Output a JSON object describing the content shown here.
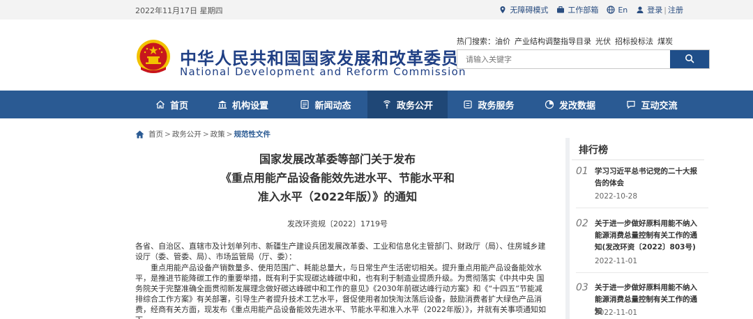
{
  "topbar": {
    "date": "2022年11月17日 星期四",
    "accessibility": "无障碍模式",
    "work_dept": "工作部箱",
    "lang": "En",
    "login": "登录",
    "sep": "|",
    "register": "注册"
  },
  "header": {
    "title_cn": "中华人民共和国国家发展和改革委员会",
    "title_en": "National Development and Reform Commission",
    "hot_label": "热门搜索：",
    "hot_items": [
      "油价",
      "产业结构调整指导目录",
      "光伏",
      "招标投标法",
      "煤炭"
    ],
    "search_placeholder": "请输入关键字"
  },
  "nav": [
    {
      "label": "首页",
      "icon": "home-icon"
    },
    {
      "label": "机构设置",
      "icon": "building-icon"
    },
    {
      "label": "新闻动态",
      "icon": "news-icon"
    },
    {
      "label": "政务公开",
      "icon": "broadcast-icon",
      "active": true
    },
    {
      "label": "政务服务",
      "icon": "service-icon"
    },
    {
      "label": "发改数据",
      "icon": "data-icon"
    },
    {
      "label": "互动交流",
      "icon": "chat-icon"
    }
  ],
  "breadcrumb": [
    "首页",
    "政务公开",
    "政策",
    "规范性文件"
  ],
  "article": {
    "title_l1": "国家发展改革委等部门关于发布",
    "title_l2": "《重点用能产品设备能效先进水平、节能水平和",
    "title_l3": "准入水平（2022年版）》的通知",
    "doc_no": "发改环资规〔2022〕1719号",
    "p1": "各省、自治区、直辖市及计划单列市、新疆生产建设兵团发展改革委、工业和信息化主管部门、财政厅（局）、住房城乡建设厅（委、管委、局）、市场监管局（厅、委）：",
    "p2": "重点用能产品设备产销数量多、使用范围广、耗能总量大，与日常生产生活密切相关。提升重点用能产品设备能效水平，是推进节能降碳工作的重要举措，既有利于实现碳达峰碳中和，也有利于制造业提质升级。为贯彻落实《中共中央 国务院关于完整准确全面贯彻新发展理念做好碳达峰碳中和工作的意见》《2030年前碳达峰行动方案》和《“十四五”节能减排综合工作方案》有关部署，引导生产者提升技术工艺水平，督促使用者加快淘汰落后设备，鼓励消费者扩大绿色产品消费，经商有关方面，现发布《重点用能产品设备能效先进水平、节能水平和准入水平（2022年版）》，并就有关事项通知如下。"
  },
  "ranking": {
    "title": "排行榜",
    "items": [
      {
        "no": "01",
        "title": "学习习近平总书记党的二十大报告的体会",
        "date": "2022-10-28"
      },
      {
        "no": "02",
        "title": "关于进一步做好原料用能不纳入能源消费总量控制有关工作的通知(发改环资〔2022〕803号)",
        "date": "2022-11-01"
      },
      {
        "no": "03",
        "title": "关于进一步做好原料用能不纳入能源消费总量控制有关工作的通知",
        "date": "2022-11-01"
      }
    ]
  },
  "colors": {
    "primary": "#1f3f84",
    "nav_bg": "#2a5a93",
    "nav_active": "#1f4776",
    "emblem_red": "#c8161d",
    "emblem_gold": "#f2c200"
  }
}
